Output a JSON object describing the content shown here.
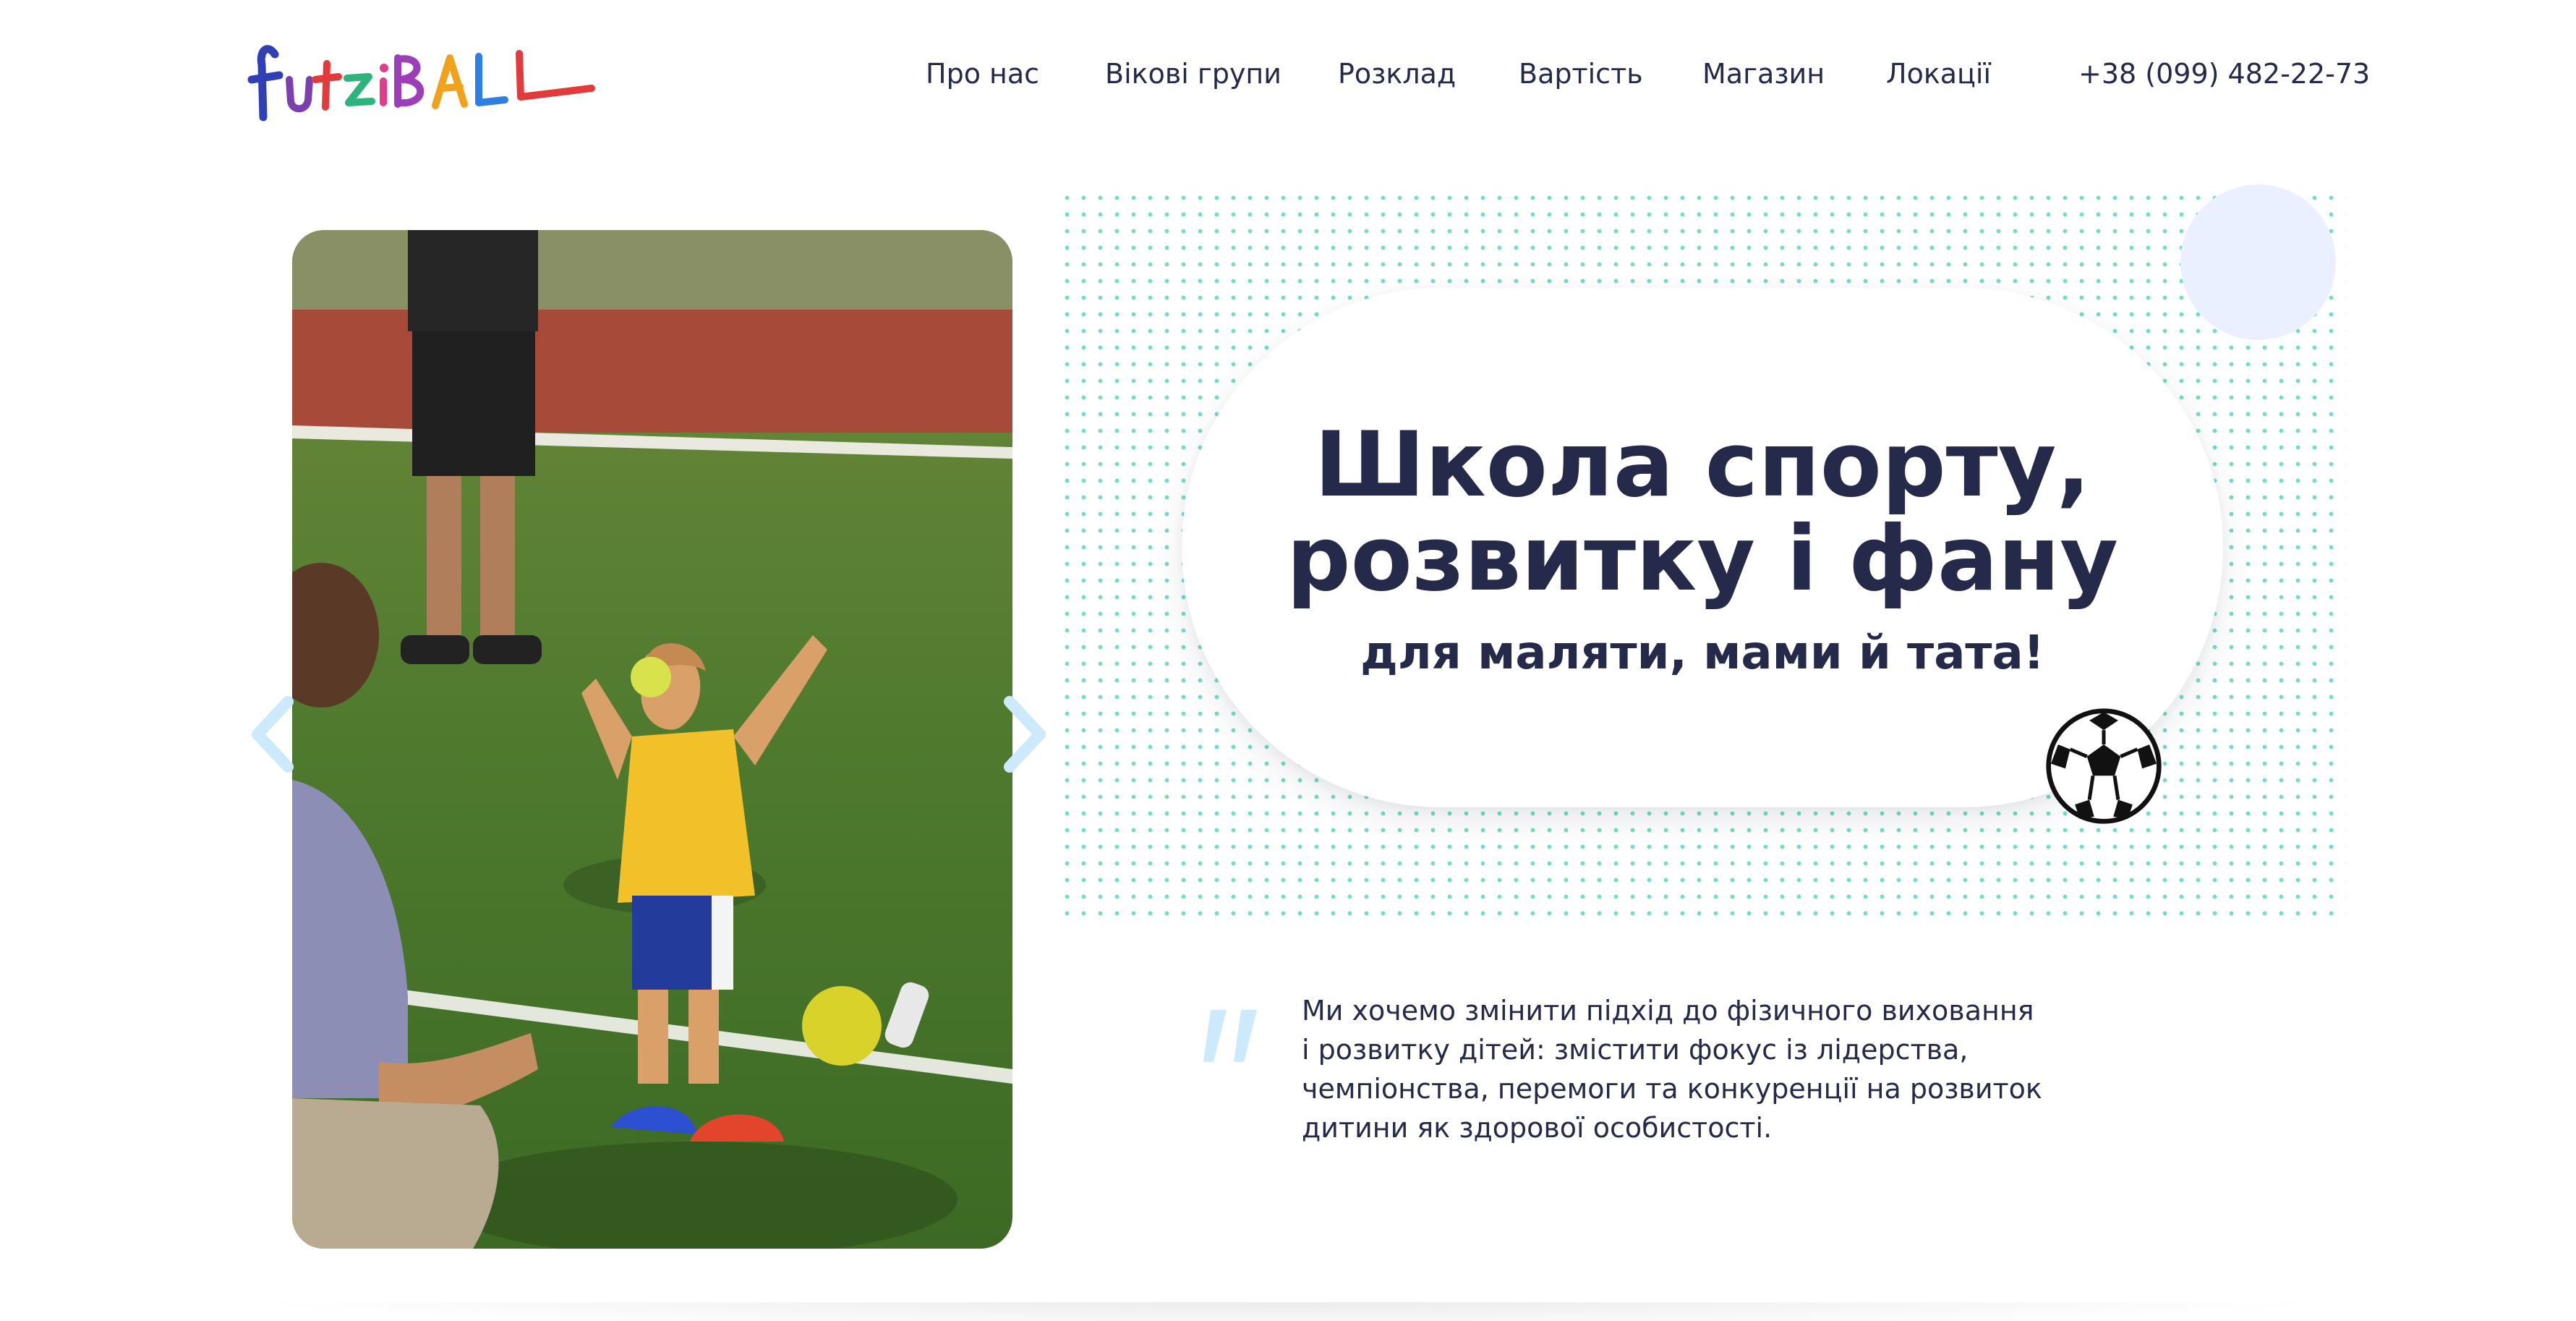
{
  "header": {
    "logo_text": "futziBALL",
    "nav": [
      {
        "label": "Про нас"
      },
      {
        "label": "Вікові групи"
      },
      {
        "label": "Розклад"
      },
      {
        "label": "Вартість"
      },
      {
        "label": "Магазин"
      },
      {
        "label": "Локації"
      }
    ],
    "phone": "+38 (099) 482-22-73"
  },
  "hero": {
    "title_line1": "Школа спорту,",
    "title_line2": "розвитку і фану",
    "subtitle": "для маляти, мами й тата!",
    "ball_icon": "soccer-ball-icon"
  },
  "slider": {
    "photo_description_icon": "photo",
    "prev_icon": "chevron-left-icon",
    "next_icon": "chevron-right-icon"
  },
  "quote": {
    "icon": "quote-icon",
    "lines": [
      "Ми хочемо змінити підхід до фізичного виховання",
      "і розвитку дітей: змістити фокус із лідерства,",
      "чемпіонства, перемоги та конкуренції на розвиток",
      "дитини як здорової особистості."
    ]
  },
  "colors": {
    "text": "#25294a",
    "dots": "#72dcc4",
    "arrow": "#cdeafc",
    "bubble": "#eaf0ff",
    "quote_mark": "#cdeafc"
  }
}
